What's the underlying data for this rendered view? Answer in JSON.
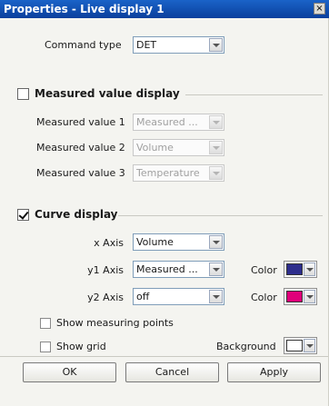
{
  "window": {
    "title": "Properties - Live display 1",
    "close_glyph": "×"
  },
  "command": {
    "label": "Command type",
    "value": "DET"
  },
  "measured_section": {
    "title": "Measured value display",
    "checked": false,
    "rows": [
      {
        "label": "Measured value 1",
        "value": "Measured ..."
      },
      {
        "label": "Measured value 2",
        "value": "Volume"
      },
      {
        "label": "Measured value 3",
        "value": "Temperature"
      }
    ]
  },
  "curve_section": {
    "title": "Curve display",
    "checked": true,
    "x_axis": {
      "label": "x Axis",
      "value": "Volume"
    },
    "y1_axis": {
      "label": "y1 Axis",
      "value": "Measured ...",
      "color_label": "Color",
      "color": "#2e2e8c"
    },
    "y2_axis": {
      "label": "y2 Axis",
      "value": "off",
      "color_label": "Color",
      "color": "#e0007a"
    },
    "show_points": {
      "label": "Show measuring points",
      "checked": false
    },
    "show_grid": {
      "label": "Show grid",
      "checked": false
    },
    "background": {
      "label": "Background",
      "color": "#ffffff"
    }
  },
  "buttons": {
    "ok": "OK",
    "cancel": "Cancel",
    "apply": "Apply"
  },
  "icons": {
    "dropdown": "chevron-down-icon",
    "check": "check-icon",
    "close": "close-icon"
  }
}
